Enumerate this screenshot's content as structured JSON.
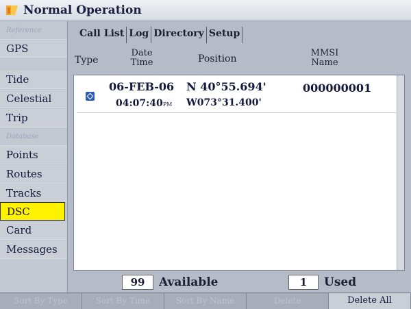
{
  "window": {
    "title": "Normal Operation",
    "icon": "garmin-app-icon"
  },
  "sidebar": {
    "items": [
      {
        "label": "Reference",
        "type": "header"
      },
      {
        "label": "GPS"
      },
      {
        "label": "Tide"
      },
      {
        "label": "Celestial"
      },
      {
        "label": "Trip"
      },
      {
        "label": "Database",
        "type": "header"
      },
      {
        "label": "Points"
      },
      {
        "label": "Routes"
      },
      {
        "label": "Tracks"
      },
      {
        "label": "DSC",
        "selected": true
      },
      {
        "label": "Card"
      },
      {
        "label": "Messages"
      }
    ]
  },
  "tabs": [
    {
      "label": "Call List",
      "active": true
    },
    {
      "label": "Log"
    },
    {
      "label": "Directory"
    },
    {
      "label": "Setup"
    }
  ],
  "columns": {
    "type": "Type",
    "date_line1": "Date",
    "date_line2": "Time",
    "position": "Position",
    "mmsi_line1": "MMSI",
    "mmsi_line2": "Name"
  },
  "rows": [
    {
      "type_icon": "dsc-call-icon",
      "date": "06-FEB-06",
      "time": "04:07:40",
      "ampm": "PM",
      "lat": "N  40°55.694'",
      "lon": "W073°31.400'",
      "mmsi": "000000001"
    }
  ],
  "footer": {
    "available_count": "99",
    "available_label": "Available",
    "used_count": "1",
    "used_label": "Used"
  },
  "softkeys": [
    {
      "label": "Sort By Type",
      "enabled": false
    },
    {
      "label": "Sort By Time",
      "enabled": false
    },
    {
      "label": "Sort By Name",
      "enabled": false
    },
    {
      "label": "Delete",
      "enabled": false
    },
    {
      "label": "Delete All",
      "enabled": true
    }
  ]
}
